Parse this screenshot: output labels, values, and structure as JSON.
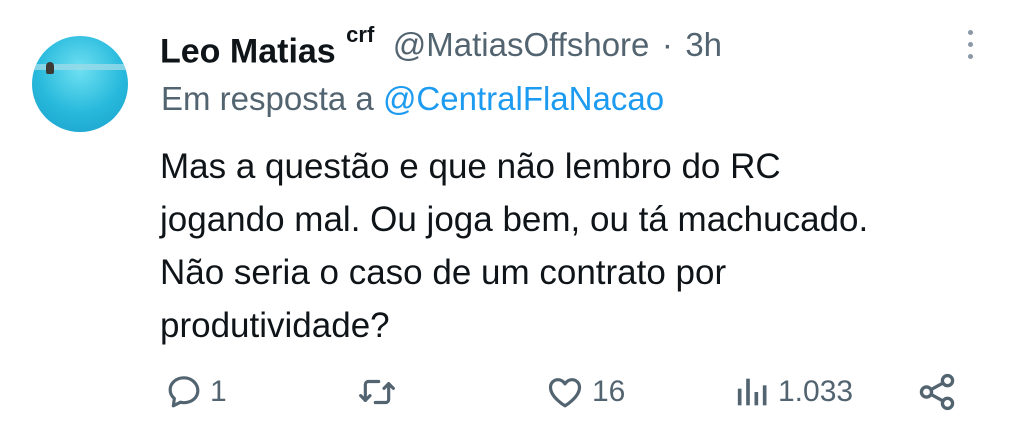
{
  "tweet": {
    "display_name": "Leo Matias",
    "badge_text": "crf",
    "handle": "@MatiasOffshore",
    "separator": "·",
    "time": "3h",
    "reply_prefix": "Em resposta a",
    "reply_mention": "@CentralFlaNacao",
    "text_lines": [
      "Mas a questão e que não lembro do RC",
      "jogando mal. Ou joga bem, ou tá machucado.",
      "Não seria o caso de um contrato por",
      "produtividade?"
    ]
  },
  "actions": {
    "reply": {
      "icon": "reply-bubble-icon",
      "count": "1"
    },
    "retweet": {
      "icon": "retweet-icon",
      "count": ""
    },
    "like": {
      "icon": "heart-icon",
      "count": "16"
    },
    "views": {
      "icon": "views-bar-chart-icon",
      "count": "1.033"
    },
    "share": {
      "icon": "share-icon"
    }
  },
  "colors": {
    "text": "#0f1419",
    "secondary": "#536471",
    "accent": "#1d9bf0",
    "background": "#ffffff"
  }
}
